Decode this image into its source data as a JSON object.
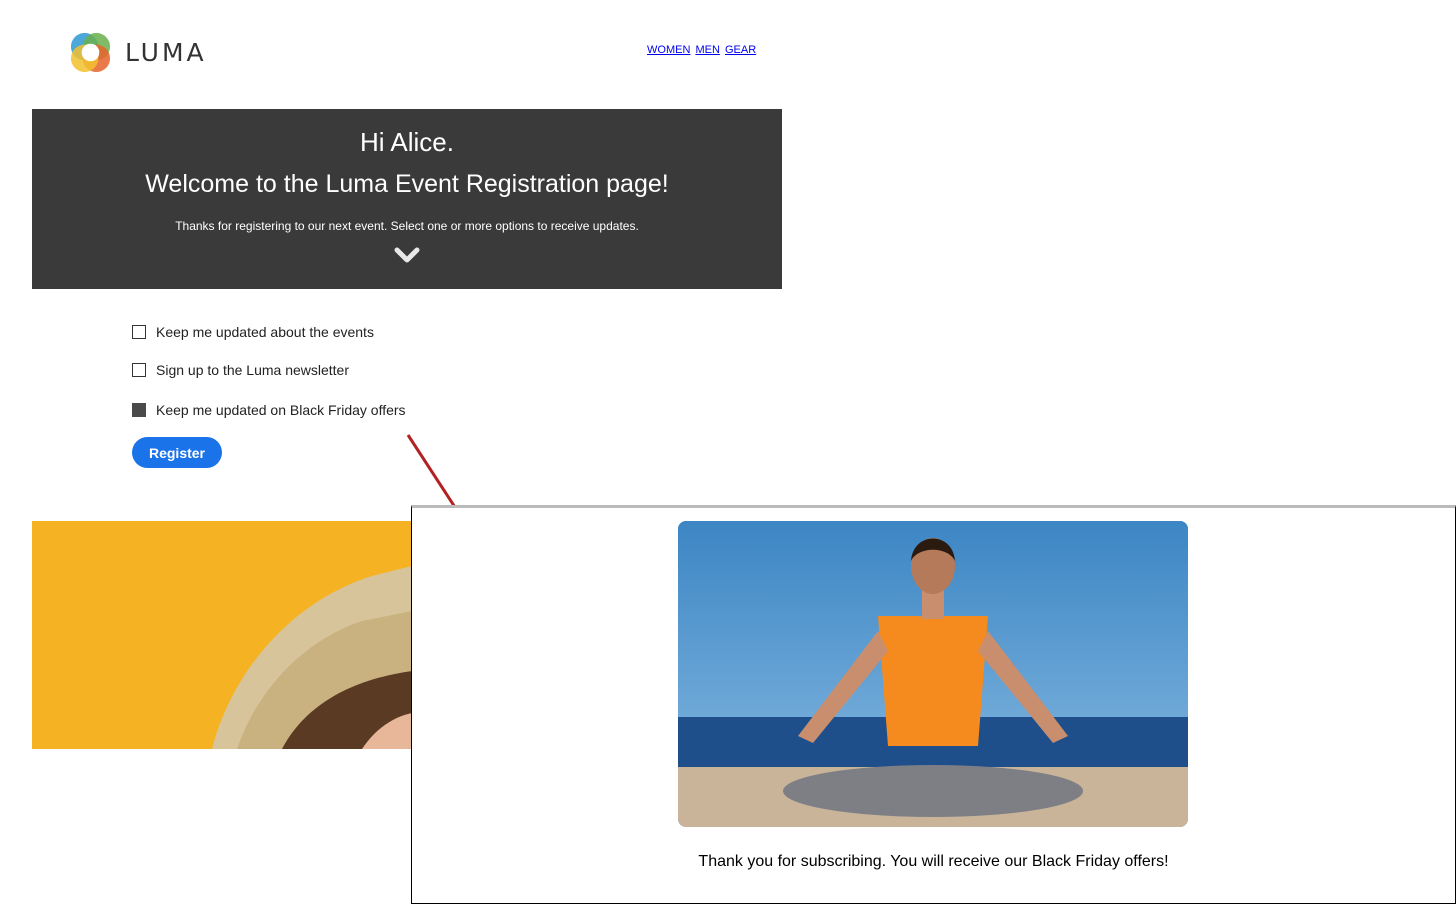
{
  "header": {
    "brand": "LUMA",
    "nav": [
      "WOMEN",
      "MEN",
      "GEAR"
    ]
  },
  "hero": {
    "greeting": "Hi Alice.",
    "welcome": "Welcome to the Luma Event Registration page!",
    "subtitle": "Thanks for registering to our next event. Select one or more options to receive updates."
  },
  "options": [
    {
      "label": "Keep me updated about the events",
      "checked": false
    },
    {
      "label": "Sign up to the Luma newsletter",
      "checked": false
    },
    {
      "label": "Keep me updated on Black Friday offers",
      "checked": true
    }
  ],
  "register_label": "Register",
  "popup": {
    "message": "Thank you for subscribing. You will receive our Black Friday offers!"
  },
  "colors": {
    "hero_bg": "#3a3a3a",
    "button": "#1a73e8",
    "yellow": "#f5b324",
    "arrow": "#b22222"
  }
}
